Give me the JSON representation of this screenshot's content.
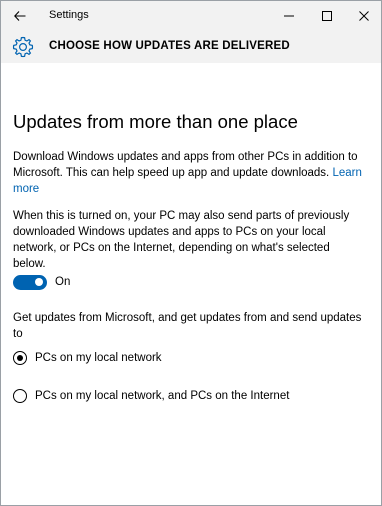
{
  "window": {
    "app_title": "Settings",
    "controls": {
      "back": "back-arrow-icon",
      "minimize": "minimize-icon",
      "maximize": "maximize-icon",
      "close": "close-icon"
    }
  },
  "header": {
    "icon": "gear-icon",
    "title": "CHOOSE HOW UPDATES ARE DELIVERED"
  },
  "main": {
    "heading": "Updates from more than one place",
    "description": "Download Windows updates and apps from other PCs in addition to Microsoft. This can help speed up app and update downloads.",
    "learn_more": "Learn more",
    "sharing_note": "When this is turned on, your PC may also send parts of previously downloaded Windows updates and apps to PCs on your local network, or PCs on the Internet, depending on what's selected below.",
    "toggle": {
      "state": "on",
      "label": "On"
    },
    "source_prompt": "Get updates from Microsoft, and get updates from and send updates to",
    "options": [
      {
        "label": "PCs on my local network",
        "selected": true
      },
      {
        "label": "PCs on my local network, and PCs on the Internet",
        "selected": false
      }
    ]
  },
  "colors": {
    "accent": "#0063b1",
    "chrome_bg": "#f2f2f2",
    "text": "#000000"
  }
}
